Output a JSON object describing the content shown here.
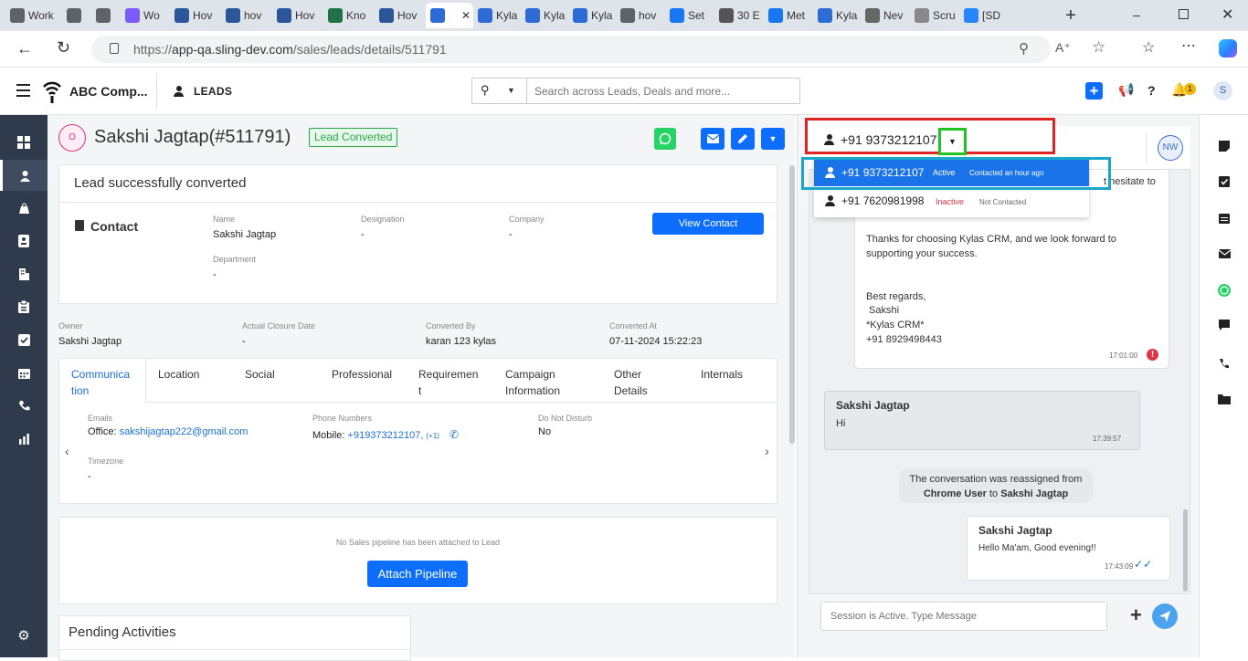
{
  "browser": {
    "tabs": [
      {
        "label": "Work",
        "icon": "profile-icon",
        "color": "#5f6368"
      },
      {
        "label": "",
        "icon": "workspaces-icon",
        "color": "#5f6368"
      },
      {
        "label": "",
        "icon": "tab-actions-icon",
        "color": "#5f6368"
      },
      {
        "label": "Wo",
        "icon": "copilot-icon",
        "color": "#7b5cff"
      },
      {
        "label": "Hov",
        "icon": "word-icon",
        "color": "#2b579a"
      },
      {
        "label": "hov",
        "icon": "word-icon",
        "color": "#2b579a"
      },
      {
        "label": "Hov",
        "icon": "word-icon",
        "color": "#2b579a"
      },
      {
        "label": "Kno",
        "icon": "excel-icon",
        "color": "#217346"
      },
      {
        "label": "Hov",
        "icon": "word-icon",
        "color": "#2b579a"
      },
      {
        "label": "",
        "icon": "kylas-icon",
        "color": "#2d6bd6"
      },
      {
        "label": "Kyla",
        "icon": "kylas-icon",
        "color": "#2d6bd6"
      },
      {
        "label": "Kyla",
        "icon": "kylas-icon",
        "color": "#2d6bd6"
      },
      {
        "label": "Kyla",
        "icon": "kylas-icon",
        "color": "#2d6bd6"
      },
      {
        "label": "hov",
        "icon": "search-icon",
        "color": "#5f6368"
      },
      {
        "label": "Set",
        "icon": "meta-icon",
        "color": "#1877f2"
      },
      {
        "label": "30 E",
        "icon": "s-icon",
        "color": "#555"
      },
      {
        "label": "Met",
        "icon": "meta-icon",
        "color": "#1877f2"
      },
      {
        "label": "Kyla",
        "icon": "kylas-icon",
        "color": "#2d6bd6"
      },
      {
        "label": "Nev",
        "icon": "page-icon",
        "color": "#666"
      },
      {
        "label": "Scru",
        "icon": "scrum-icon",
        "color": "#888"
      },
      {
        "label": "[SD",
        "icon": "jira-icon",
        "color": "#2684ff"
      }
    ],
    "url_prefix": "https://",
    "url_host": "app-qa.sling-dev.com",
    "url_path": "/sales/leads/details/511791"
  },
  "header": {
    "company": "ABC Comp...",
    "module": "LEADS",
    "search_placeholder": "Search across Leads, Deals and more...",
    "notif_count": "1",
    "avatar": "S"
  },
  "lead": {
    "avatar_letter": "O",
    "title": "Sakshi Jagtap(#511791)",
    "status_badge": "Lead Converted",
    "success_msg": "Lead successfully converted",
    "contact": {
      "heading": "Contact",
      "view_button": "View Contact",
      "fields": [
        {
          "label": "Name",
          "value": "Sakshi Jagtap"
        },
        {
          "label": "Designation",
          "value": "-"
        },
        {
          "label": "Company",
          "value": "-"
        },
        {
          "label": "Department",
          "value": "-"
        }
      ]
    },
    "meta": [
      {
        "label": "Owner",
        "value": "Sakshi Jagtap"
      },
      {
        "label": "Actual Closure Date",
        "value": "-"
      },
      {
        "label": "Converted By",
        "value": "karan 123 kylas"
      },
      {
        "label": "Converted At",
        "value": "07-11-2024 15:22:23"
      }
    ],
    "tabs": [
      {
        "l1": "Communica",
        "l2": "tion"
      },
      {
        "l1": "Location",
        "l2": ""
      },
      {
        "l1": "Social",
        "l2": ""
      },
      {
        "l1": "Professional",
        "l2": ""
      },
      {
        "l1": "Requiremen",
        "l2": "t"
      },
      {
        "l1": "Campaign",
        "l2": "Information"
      },
      {
        "l1": "Other",
        "l2": "Details"
      },
      {
        "l1": "Internals",
        "l2": ""
      }
    ],
    "communication": {
      "emails_label": "Emails",
      "email_prefix": "Office:",
      "email": "sakshijagtap222@gmail.com",
      "phones_label": "Phone Numbers",
      "phone_prefix": "Mobile:",
      "phone": "+919373212107,",
      "phone_more": "(+1)",
      "dnd_label": "Do Not Disturb",
      "dnd_value": "No",
      "timezone_label": "Timezone",
      "timezone_value": "-"
    },
    "pipeline": {
      "empty_msg": "No Sales pipeline has been attached to Lead",
      "button": "Attach Pipeline"
    },
    "pending_title": "Pending Activities"
  },
  "chat": {
    "selected_phone": "+91 9373212107",
    "agent_avatar": "NW",
    "phone_options": [
      {
        "number": "+91 9373212107",
        "status": "Active",
        "note": "Contacted an hour ago"
      },
      {
        "number": "+91 7620981998",
        "status": "Inactive",
        "note": "Not Contacted"
      }
    ],
    "msg1_cut": "t hesitate to",
    "msg1_lines": [
      "Thanks for choosing Kylas CRM, and we look forward to",
      "supporting your success.",
      "Best regards,",
      " Sakshi",
      "*Kylas CRM*",
      "+91 8929498443"
    ],
    "msg1_time": "17:01:00",
    "msg2_sender": "Sakshi Jagtap",
    "msg2_text": "Hi",
    "msg2_time": "17:39:57",
    "system_line1": "The conversation was reassigned from",
    "system_from": "Chrome User",
    "system_to_word": "to",
    "system_to": "Sakshi Jagtap",
    "msg3_sender": "Sakshi Jagtap",
    "msg3_text": "Hello Ma'am, Good evening!!",
    "msg3_time": "17:43:09",
    "input_placeholder": "Session is Active. Type Message"
  },
  "colors": {
    "primary": "#0d6efd",
    "sidebar": "#2f3b4c",
    "badge_green": "#28a745",
    "whatsapp": "#25d366",
    "inactive_red": "#dc3545",
    "highlight_red": "#e02424",
    "highlight_green": "#22c322",
    "highlight_cyan": "#1aa7c9"
  }
}
